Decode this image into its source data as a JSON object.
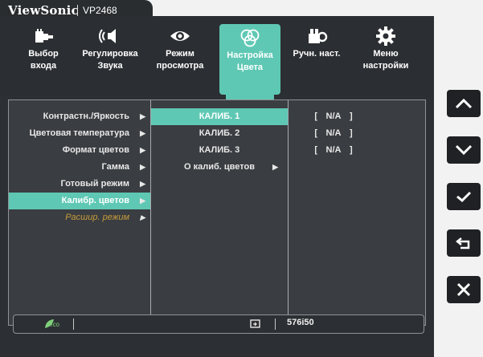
{
  "brand": {
    "name": "ViewSonic",
    "model": "VP2468"
  },
  "menu": [
    {
      "label_line1": "Выбор",
      "label_line2": "входа",
      "icon": "input-select-icon"
    },
    {
      "label_line1": "Регулировка",
      "label_line2": "Звука",
      "icon": "speaker-icon"
    },
    {
      "label_line1": "Режим",
      "label_line2": "просмотра",
      "icon": "eye-icon"
    },
    {
      "label_line1": "Настройка",
      "label_line2": "Цвета",
      "icon": "color-circles-icon",
      "active": true
    },
    {
      "label_line1": "Ручн. наст.",
      "label_line2": "",
      "icon": "manual-tune-icon"
    },
    {
      "label_line1": "Меню",
      "label_line2": "настройки",
      "icon": "gear-icon"
    }
  ],
  "left_list": [
    {
      "label": "Контрастн./Яркость"
    },
    {
      "label": "Цветовая температура"
    },
    {
      "label": "Формат цветов"
    },
    {
      "label": "Гамма"
    },
    {
      "label": "Готовый режим"
    },
    {
      "label": "Калибр. цветов",
      "selected": true
    },
    {
      "label": "Расшир. режим",
      "disabled": true
    }
  ],
  "mid_list": [
    {
      "label": "КАЛИБ. 1",
      "selected": true
    },
    {
      "label": "КАЛИБ. 2"
    },
    {
      "label": "КАЛИБ. 3"
    },
    {
      "label": "О калиб. цветов",
      "has_arrow": true
    }
  ],
  "right_values": [
    {
      "value": "N/A"
    },
    {
      "value": "N/A"
    },
    {
      "value": "N/A"
    }
  ],
  "status": {
    "eco": "eco",
    "resolution": "576i50"
  },
  "colors": {
    "accent": "#5fc8b4",
    "background": "#2c2f33",
    "disabled_text": "#c79c3b"
  },
  "side_buttons": [
    {
      "icon": "chevron-up-icon",
      "glyph": "∧"
    },
    {
      "icon": "chevron-down-icon",
      "glyph": "∨"
    },
    {
      "icon": "check-icon",
      "glyph": "✓"
    },
    {
      "icon": "return-icon",
      "glyph": "⮌"
    },
    {
      "icon": "close-icon",
      "glyph": "✕"
    }
  ]
}
